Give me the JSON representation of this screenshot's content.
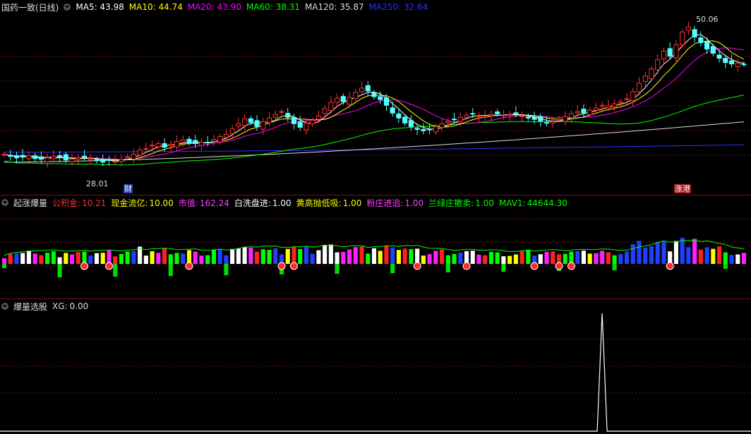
{
  "main": {
    "title": "国药一致(日线)",
    "ma": [
      {
        "label": "MA5: 43.98",
        "color": "#ffffff"
      },
      {
        "label": "MA10: 44.74",
        "color": "#ffff00"
      },
      {
        "label": "MA20: 43.90",
        "color": "#ff00ff"
      },
      {
        "label": "MA60: 38.31",
        "color": "#00ff00"
      },
      {
        "label": "MA120: 35.87",
        "color": "#dddddd"
      },
      {
        "label": "MA250: 32.64",
        "color": "#3030ff"
      }
    ],
    "high_label": "50.06",
    "low_label": "28.01",
    "event_left": "财",
    "event_right": "涨港"
  },
  "indicator": {
    "title": "起涨爆量",
    "items": [
      {
        "label": "公积金:",
        "value": "10.21",
        "color": "#ff3030"
      },
      {
        "label": "现金流亿:",
        "value": "10.00",
        "color": "#ffff00"
      },
      {
        "label": "市值:",
        "value": "162.24",
        "color": "#ff40ff"
      },
      {
        "label": "白洗盘进:",
        "value": "1.00",
        "color": "#ffffff"
      },
      {
        "label": "黄高抛低吸:",
        "value": "1.00",
        "color": "#ffff00"
      },
      {
        "label": "粉庄进追:",
        "value": "1.00",
        "color": "#ff40ff"
      },
      {
        "label": "兰绿庄撤卖:",
        "value": "1.00",
        "color": "#00ff00"
      },
      {
        "label": "MAV1:",
        "value": "44644.30",
        "color": "#00ff00"
      }
    ]
  },
  "selector": {
    "title": "爆量选股",
    "xg_label": "XG:",
    "xg_value": "0.00"
  },
  "colors": {
    "up": "#ff3333",
    "down": "#54ffff",
    "grid": "#7a1010"
  },
  "chart_data": {
    "type": "candlestick",
    "closes": [
      31.3,
      31.0,
      30.8,
      30.9,
      31.1,
      30.7,
      30.6,
      30.8,
      31.0,
      30.9,
      30.5,
      30.6,
      30.8,
      30.9,
      30.7,
      30.4,
      30.2,
      30.5,
      30.3,
      30.6,
      31.0,
      31.3,
      31.9,
      32.1,
      32.6,
      32.8,
      32.3,
      32.7,
      33.1,
      33.3,
      32.9,
      32.8,
      33.0,
      32.9,
      33.4,
      33.8,
      34.1,
      34.9,
      35.6,
      36.3,
      35.8,
      35.2,
      35.9,
      36.4,
      36.9,
      37.3,
      36.5,
      35.6,
      35.1,
      35.7,
      36.1,
      36.7,
      37.7,
      38.6,
      39.2,
      38.7,
      39.3,
      40.0,
      40.6,
      40.2,
      39.4,
      39.0,
      38.2,
      37.1,
      36.4,
      35.7,
      35.2,
      34.8,
      34.6,
      34.8,
      35.2,
      35.6,
      35.9,
      36.2,
      36.5,
      36.8,
      37.0,
      36.7,
      36.6,
      36.9,
      37.0,
      36.8,
      36.9,
      37.0,
      36.7,
      36.4,
      36.2,
      36.0,
      35.7,
      35.9,
      36.3,
      36.6,
      37.0,
      37.3,
      37.1,
      37.5,
      37.8,
      38.2,
      38.1,
      38.4,
      38.7,
      39.1,
      40.1,
      41.3,
      42.3,
      43.3,
      44.6,
      45.8,
      45.1,
      46.7,
      48.5,
      49.2,
      47.8,
      47.0,
      46.1,
      45.5,
      44.8,
      44.2,
      44.0,
      44.1,
      43.98
    ],
    "ma": {
      "MA5": {
        "color": "#ffffff",
        "last": 43.98
      },
      "MA10": {
        "color": "#ffff00",
        "last": 44.74
      },
      "MA20": {
        "color": "#ff00ff",
        "last": 43.9
      },
      "MA60": {
        "color": "#00ff00",
        "last": 38.31
      },
      "MA120": {
        "color": "#dddddd",
        "last": 35.87
      },
      "MA250": {
        "color": "#3030ff",
        "last": 32.64
      }
    },
    "high": 50.06,
    "low": 28.01,
    "xg_signal_index": 97
  }
}
